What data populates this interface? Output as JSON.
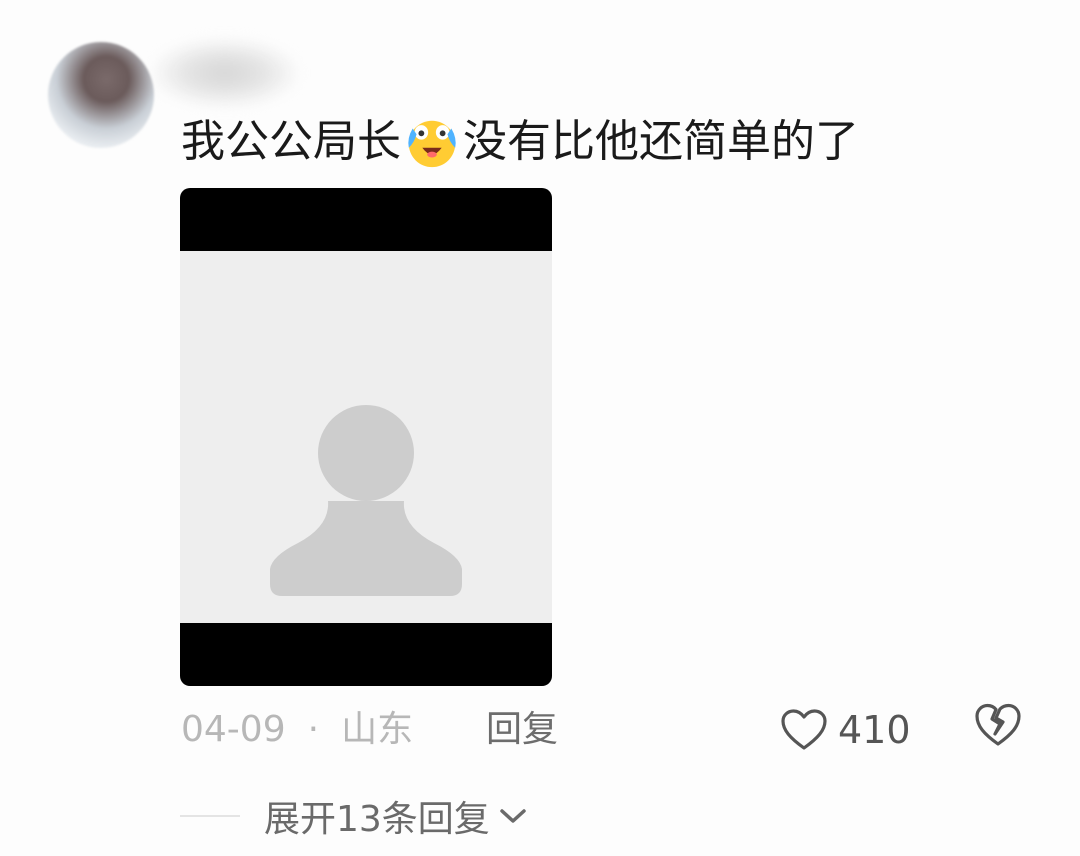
{
  "comment": {
    "text_before": "我公公局长",
    "emoji": "crying-laughing-emoji",
    "text_after": "没有比他还简单的了"
  },
  "meta": {
    "date": "04-09",
    "separator": "·",
    "location": "山东",
    "reply_label": "回复"
  },
  "actions": {
    "like_count": "410",
    "like_icon": "heart-icon",
    "dislike_icon": "broken-heart-icon"
  },
  "replies": {
    "expand_label": "展开13条回复"
  },
  "colors": {
    "text_primary": "#1a1a1a",
    "text_meta": "#b7b7b7",
    "media_background": "#eeeeee",
    "placeholder_figure": "#cdcdcd"
  }
}
